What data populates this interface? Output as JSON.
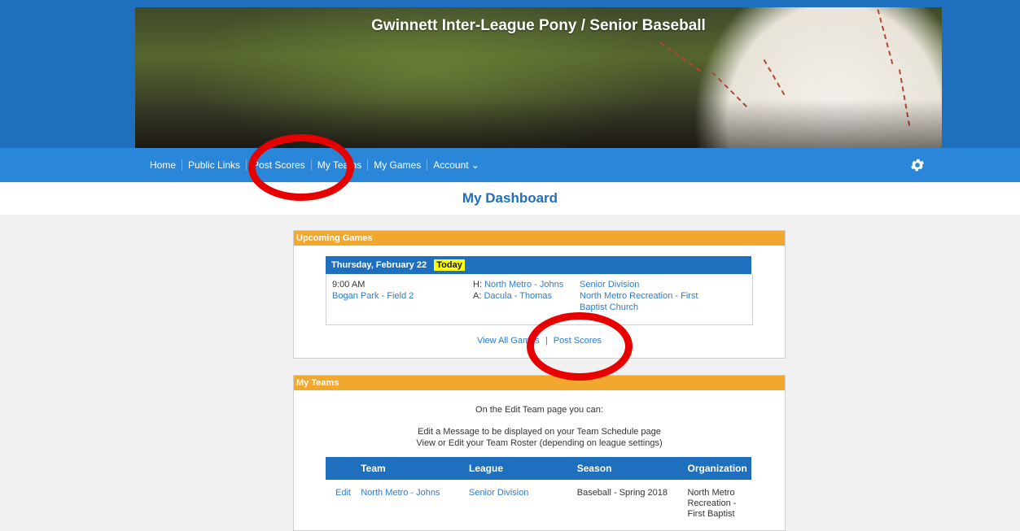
{
  "site": {
    "title": "Gwinnett Inter-League Pony / Senior Baseball"
  },
  "nav": {
    "items": [
      {
        "label": "Home"
      },
      {
        "label": "Public Links"
      },
      {
        "label": "Post Scores"
      },
      {
        "label": "My Teams"
      },
      {
        "label": "My Games"
      },
      {
        "label": "Account ⌄"
      }
    ]
  },
  "page": {
    "title": "My Dashboard"
  },
  "upcoming": {
    "heading": "Upcoming Games",
    "day": "Thursday, February 22",
    "today_badge": "Today",
    "game": {
      "time": "9:00 AM",
      "field": "Bogan Park - Field 2",
      "home_prefix": "H:",
      "home_team": "North Metro - Johns",
      "away_prefix": "A:",
      "away_team": "Dacula - Thomas",
      "division": "Senior Division",
      "organization": "North Metro Recreation - First Baptist Church"
    },
    "view_all": "View All Games",
    "separator": "|",
    "post_scores": "Post Scores"
  },
  "teams": {
    "heading": "My Teams",
    "intro": "On the Edit Team page you can:",
    "line1": "Edit a Message to be displayed on your Team Schedule page",
    "line2": "View or Edit your Team Roster (depending on league settings)",
    "columns": {
      "team": "Team",
      "league": "League",
      "season": "Season",
      "organization": "Organization"
    },
    "rows": [
      {
        "edit": "Edit",
        "team": "North Metro - Johns",
        "league": "Senior Division",
        "season": "Baseball - Spring 2018",
        "organization": "North Metro Recreation - First Baptist"
      }
    ]
  },
  "colors": {
    "nav_blue": "#2a86d8",
    "header_blue": "#1f6fbf",
    "panel_orange": "#f2a72e",
    "annotation_red": "#e60000",
    "today_yellow": "#ffff00"
  },
  "icons": {
    "settings": "gear-icon"
  }
}
